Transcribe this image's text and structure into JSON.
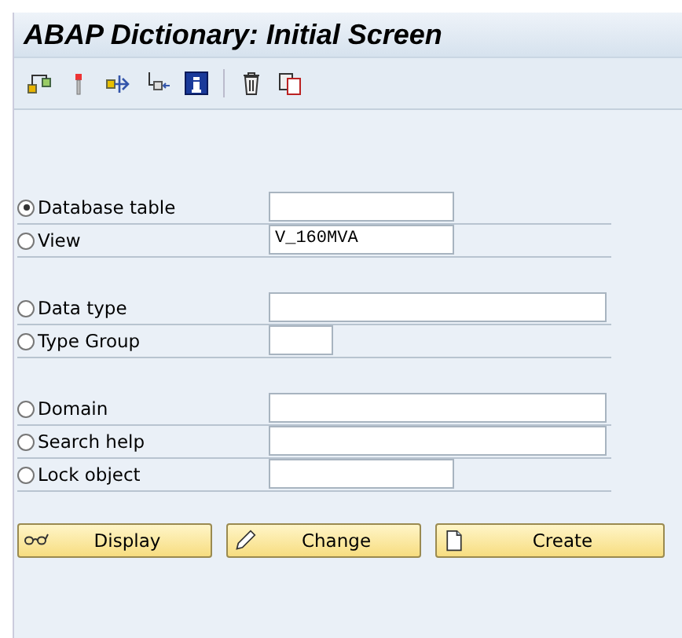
{
  "window": {
    "title": "ABAP Dictionary: Initial Screen"
  },
  "toolbar": {
    "icons": [
      {
        "kind": "hierarchy"
      },
      {
        "kind": "pin"
      },
      {
        "kind": "arrow-out"
      },
      {
        "kind": "arrow-in"
      },
      {
        "kind": "info"
      },
      {
        "kind": "separator"
      },
      {
        "kind": "trash"
      },
      {
        "kind": "copy"
      }
    ]
  },
  "groups": [
    {
      "rows": [
        {
          "label": "Database table",
          "selected": true,
          "kind": "medium"
        },
        {
          "label": "View",
          "selected": false,
          "kind": "medium",
          "value": "V_160MVA"
        }
      ]
    },
    {
      "rows": [
        {
          "label": "Data type",
          "selected": false,
          "kind": "long"
        },
        {
          "label": "Type Group",
          "selected": false,
          "kind": "small"
        }
      ]
    },
    {
      "rows": [
        {
          "label": "Domain",
          "selected": false,
          "kind": "long"
        },
        {
          "label": "Search help",
          "selected": false,
          "kind": "long"
        },
        {
          "label": "Lock object",
          "selected": false,
          "kind": "medium"
        }
      ]
    }
  ],
  "buttons": [
    {
      "label": "Display",
      "kind": "display"
    },
    {
      "label": "Change",
      "kind": "change"
    },
    {
      "label": "Create",
      "kind": "create"
    }
  ]
}
